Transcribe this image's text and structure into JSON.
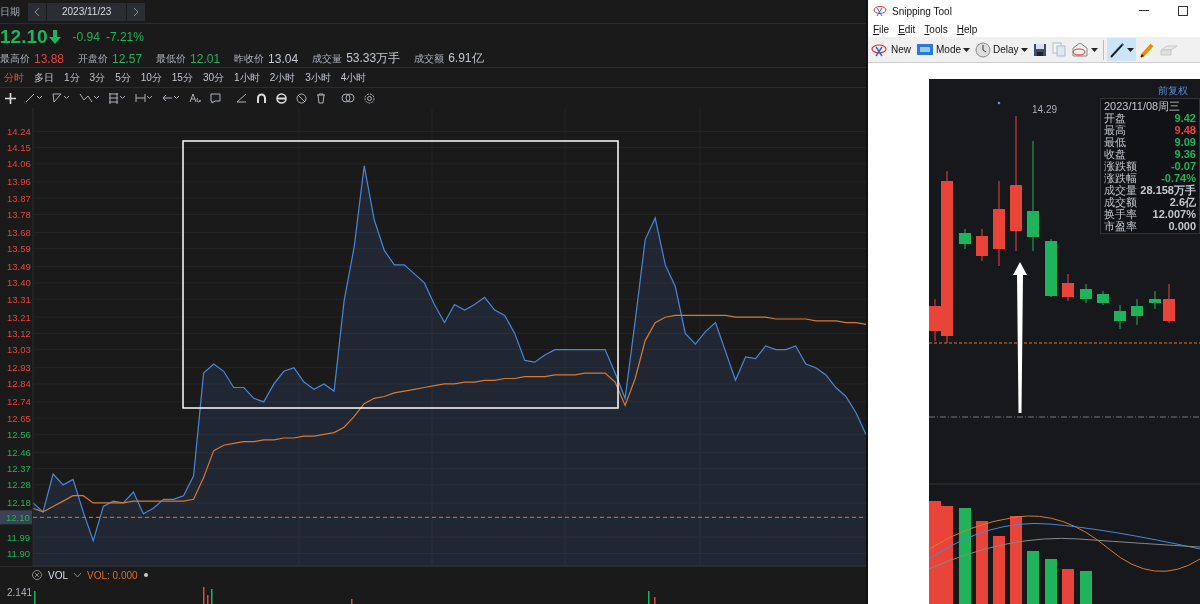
{
  "left_panel": {
    "date_bar": {
      "label": "日期",
      "date": "2023/11/23"
    },
    "quote": {
      "price": "12.10",
      "down": true,
      "change": "-0.94",
      "change_pct": "-7.21%"
    },
    "stats": [
      {
        "label": "最高价",
        "value": "13.88",
        "color": "#e8443a"
      },
      {
        "label": "开盘价",
        "value": "12.57",
        "color": "#1fb35b"
      },
      {
        "label": "最低价",
        "value": "12.01",
        "color": "#1fb35b"
      },
      {
        "label": "昨收价",
        "value": "13.04",
        "color": "#c3c8cf"
      },
      {
        "label": "成交量",
        "value": "53.33万手",
        "color": "#c3c8cf"
      },
      {
        "label": "成交额",
        "value": "6.91亿",
        "color": "#c3c8cf"
      }
    ],
    "periods": [
      {
        "label": "分时",
        "selected": true
      },
      {
        "label": "多日",
        "selected": false
      },
      {
        "label": "1分",
        "selected": false
      },
      {
        "label": "3分",
        "selected": false
      },
      {
        "label": "5分",
        "selected": false
      },
      {
        "label": "10分",
        "selected": false
      },
      {
        "label": "15分",
        "selected": false
      },
      {
        "label": "30分",
        "selected": false
      },
      {
        "label": "1小时",
        "selected": false
      },
      {
        "label": "2小时",
        "selected": false
      },
      {
        "label": "3小时",
        "selected": false
      },
      {
        "label": "4小时",
        "selected": false
      }
    ],
    "chart_data": {
      "type": "area",
      "grid": true,
      "ylim": [
        11.83,
        14.37
      ],
      "ref_lines": [
        {
          "axis": "y",
          "value": 12.1,
          "color": "#d9782f"
        }
      ],
      "yticks": [
        {
          "value": 14.24,
          "label": "14.24"
        },
        {
          "value": 14.15,
          "label": "14.15"
        },
        {
          "value": 14.06,
          "label": "14.06"
        },
        {
          "value": 13.96,
          "label": "13.96"
        },
        {
          "value": 13.87,
          "label": "13.87"
        },
        {
          "value": 13.78,
          "label": "13.78"
        },
        {
          "value": 13.68,
          "label": "13.68"
        },
        {
          "value": 13.59,
          "label": "13.59"
        },
        {
          "value": 13.49,
          "label": "13.49"
        },
        {
          "value": 13.4,
          "label": "13.40"
        },
        {
          "value": 13.31,
          "label": "13.31"
        },
        {
          "value": 13.21,
          "label": "13.21"
        },
        {
          "value": 13.12,
          "label": "13.12"
        },
        {
          "value": 13.03,
          "label": "13.03"
        },
        {
          "value": 12.93,
          "label": "12.93"
        },
        {
          "value": 12.84,
          "label": "12.84"
        },
        {
          "value": 12.74,
          "label": "12.74"
        },
        {
          "value": 12.65,
          "label": "12.65"
        },
        {
          "value": 12.56,
          "label": "12.56"
        },
        {
          "value": 12.46,
          "label": "12.46"
        },
        {
          "value": 12.37,
          "label": "12.37"
        },
        {
          "value": 12.28,
          "label": "12.28"
        },
        {
          "value": 12.18,
          "label": "12.18"
        },
        {
          "value": 12.1,
          "label": "12.10"
        },
        {
          "value": 11.99,
          "label": "11.99"
        },
        {
          "value": 11.9,
          "label": "11.90"
        }
      ],
      "categories": [
        null,
        null,
        null,
        null,
        null,
        null,
        null,
        null,
        null,
        null,
        null,
        null,
        null,
        null,
        null,
        null,
        null,
        null,
        null,
        null,
        null,
        null,
        null,
        null,
        null,
        null,
        null,
        null,
        null,
        null,
        null,
        null,
        null,
        null,
        null,
        null,
        null,
        null,
        null,
        null,
        null,
        null,
        null,
        null,
        null,
        null,
        null,
        null,
        null,
        null,
        null,
        null,
        null,
        null,
        null,
        null,
        null,
        null,
        null,
        null,
        null,
        null,
        null,
        null,
        null,
        null,
        null,
        null,
        null,
        null,
        null,
        null,
        null,
        null,
        null,
        null,
        null,
        null,
        null,
        null,
        null,
        null,
        null,
        null
      ],
      "series": [
        {
          "color": "#4a86d8",
          "values": [
            12.18,
            12.13,
            12.34,
            12.28,
            12.31,
            12.13,
            11.97,
            12.16,
            12.19,
            12.18,
            12.24,
            12.12,
            12.15,
            12.2,
            12.2,
            12.22,
            12.33,
            12.9,
            12.95,
            12.91,
            12.82,
            12.82,
            12.76,
            12.74,
            12.84,
            12.91,
            12.93,
            12.85,
            12.81,
            12.84,
            12.8,
            13.3,
            13.6,
            14.05,
            13.75,
            13.58,
            13.5,
            13.5,
            13.45,
            13.4,
            13.28,
            13.18,
            13.28,
            13.25,
            13.28,
            13.32,
            13.25,
            13.22,
            13.12,
            12.97,
            12.96,
            13.0,
            13.03,
            13.03,
            13.03,
            13.03,
            13.03,
            13.03,
            12.9,
            12.76,
            13.19,
            13.64,
            13.76,
            13.5,
            13.38,
            13.12,
            13.06,
            13.13,
            13.18,
            13.02,
            12.86,
            12.99,
            12.98,
            13.05,
            13.03,
            13.03,
            13.05,
            12.95,
            12.93,
            12.89,
            12.82,
            12.77,
            12.68,
            12.56
          ]
        },
        {
          "type": "line",
          "color": "#d9782f",
          "values": [
            12.15,
            12.13,
            12.16,
            12.19,
            12.22,
            12.22,
            12.18,
            12.18,
            12.18,
            12.18,
            12.19,
            12.19,
            12.19,
            12.19,
            12.19,
            12.19,
            12.2,
            12.32,
            12.47,
            12.5,
            12.51,
            12.52,
            12.52,
            12.53,
            12.53,
            12.54,
            12.54,
            12.55,
            12.55,
            12.56,
            12.57,
            12.6,
            12.66,
            12.73,
            12.76,
            12.77,
            12.79,
            12.8,
            12.81,
            12.82,
            12.83,
            12.84,
            12.84,
            12.85,
            12.85,
            12.86,
            12.86,
            12.87,
            12.87,
            12.88,
            12.88,
            12.88,
            12.89,
            12.89,
            12.89,
            12.9,
            12.9,
            12.9,
            12.85,
            12.72,
            12.87,
            13.08,
            13.18,
            13.21,
            13.22,
            13.22,
            13.22,
            13.22,
            13.22,
            13.22,
            13.21,
            13.21,
            13.21,
            13.21,
            13.2,
            13.2,
            13.2,
            13.2,
            13.19,
            13.19,
            13.19,
            13.18,
            13.18,
            13.17
          ]
        }
      ]
    },
    "volume": {
      "title": "VOL",
      "reading": "VOL: 0.000",
      "axis_label": "2.141"
    }
  },
  "snipping_tool": {
    "title": "Snipping Tool",
    "menu": [
      "File",
      "Edit",
      "Tools",
      "Help"
    ],
    "toolbar": [
      {
        "kind": "new",
        "label": "New",
        "dropdown": false
      },
      {
        "kind": "mode",
        "label": "Mode",
        "dropdown": true
      },
      {
        "kind": "delay",
        "label": "Delay",
        "dropdown": true
      },
      {
        "kind": "save",
        "disabled": false,
        "selected": false,
        "dropdown": false
      },
      {
        "kind": "copy",
        "disabled": true,
        "selected": false,
        "dropdown": false
      },
      {
        "kind": "send",
        "disabled": false,
        "selected": false,
        "dropdown": true
      },
      {
        "kind": "pen",
        "disabled": false,
        "selected": true,
        "dropdown": true
      },
      {
        "kind": "highlighter",
        "disabled": false,
        "selected": false,
        "dropdown": false
      },
      {
        "kind": "eraser",
        "disabled": true,
        "selected": false,
        "dropdown": false
      }
    ],
    "capture": {
      "adjust_label": "前复权",
      "high_label": "14.29",
      "tooltip": {
        "date": "2023/11/08周三",
        "rows": [
          {
            "label": "开盘",
            "value": "9.42",
            "color": "#1fb35b"
          },
          {
            "label": "最高",
            "value": "9.48",
            "color": "#e8443a"
          },
          {
            "label": "最低",
            "value": "9.09",
            "color": "#1fb35b"
          },
          {
            "label": "收盘",
            "value": "9.36",
            "color": "#1fb35b"
          },
          {
            "label": "涨跌额",
            "value": "-0.07",
            "color": "#1fb35b"
          },
          {
            "label": "涨跌幅",
            "value": "-0.74%",
            "color": "#1fb35b"
          },
          {
            "label": "成交量",
            "value": "28.158万手",
            "color": "#c3c8cf"
          },
          {
            "label": "成交额",
            "value": "2.6亿",
            "color": "#c3c8cf"
          },
          {
            "label": "换手率",
            "value": "12.007%",
            "color": "#c3c8cf"
          },
          {
            "label": "市盈率",
            "value": "0.000",
            "color": "#c3c8cf"
          }
        ]
      }
    }
  }
}
